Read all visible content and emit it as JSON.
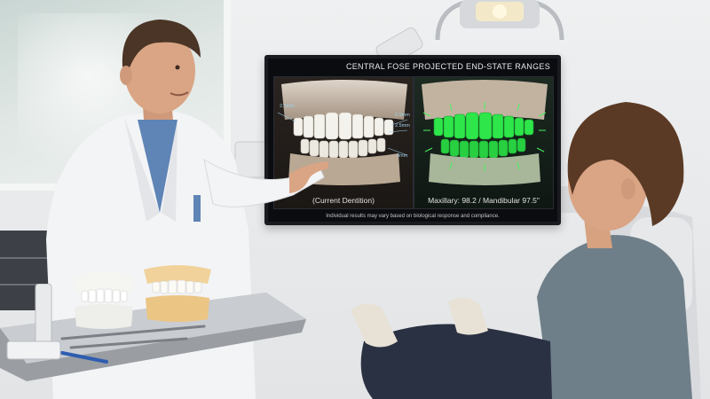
{
  "monitor": {
    "title": "CENTRAL FOSE PROJECTED END-STATE RANGES",
    "left_caption": "(Current Dentition)",
    "right_caption": "Maxillary: 98.2 / Mandibular 97.5\"",
    "footer_note": "Individual results may vary based on biological response and compliance.",
    "measurements": [
      "2.5mm",
      "2.5mm",
      "2.5mm",
      "3mm",
      "2mm"
    ]
  },
  "colors": {
    "screen_bg": "#0b0c10",
    "projection_green": "#2ee64a",
    "coat_white": "#f3f4f6",
    "scrubs_blue": "#5f84b6",
    "patient_shirt": "#6f7f89",
    "chair_gray": "#d8dadd"
  }
}
